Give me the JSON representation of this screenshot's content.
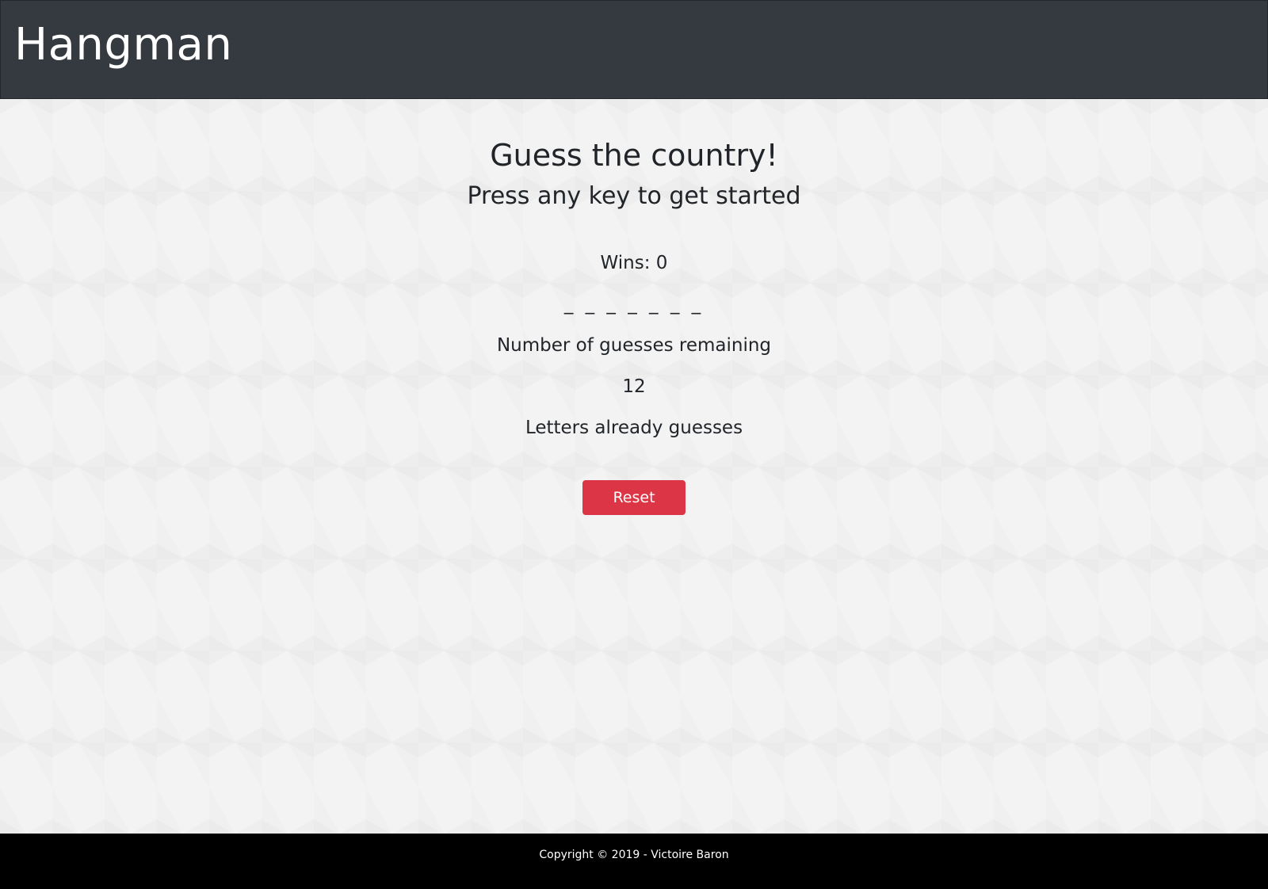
{
  "header": {
    "title": "Hangman"
  },
  "main": {
    "heading": "Guess the country!",
    "subheading": "Press any key to get started",
    "wins": "Wins: 0",
    "word": "_ _ _ _ _ _ _",
    "guesses_label": "Number of guesses remaining",
    "guesses_count": "12",
    "letters_label": "Letters already guesses",
    "reset_label": "Reset"
  },
  "footer": {
    "text": "Copyright © 2019 - Victoire Baron"
  },
  "colors": {
    "header_bg": "#343a40",
    "page_bg": "#f3f3f3",
    "reset_button": "#dc3545",
    "footer_bg": "#000000"
  }
}
